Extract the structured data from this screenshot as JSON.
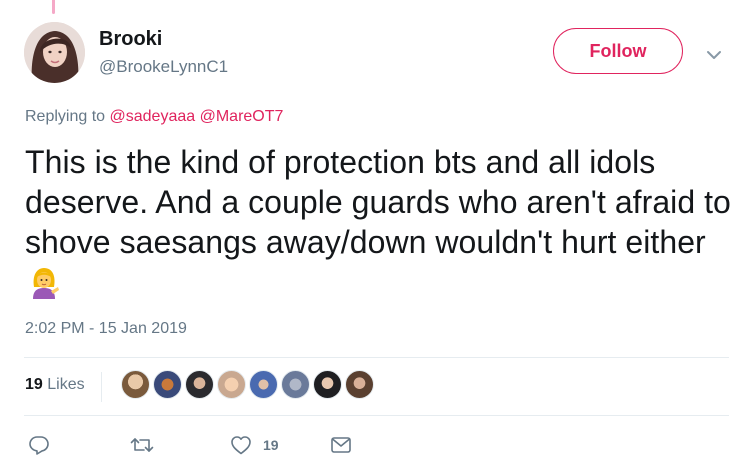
{
  "tweet": {
    "author": {
      "display_name": "Brooki",
      "screen_name": "@BrookeLynnC1",
      "avatar_icon": "user-avatar"
    },
    "follow_label": "Follow",
    "replying_prefix": "Replying to",
    "mentions": [
      "@sadeyaaa",
      "@MareOT7"
    ],
    "text": "This is the kind of protection bts and all idols deserve. And a couple guards who aren't afraid to shove saesangs away/down wouldn't hurt either",
    "emoji_icon": "person-tipping-hand-emoji",
    "timestamp": "2:02 PM - 15 Jan 2019",
    "stats": {
      "likes_count": "19",
      "likes_label": "Likes"
    },
    "actions": {
      "reply_icon": "reply-icon",
      "retweet_icon": "retweet-icon",
      "like_icon": "heart-icon",
      "like_count": "19",
      "dm_icon": "envelope-icon"
    }
  },
  "colors": {
    "accent": "#e0245e",
    "secondary_text": "#657786",
    "primary_text": "#14171a",
    "divider": "#e6ecf0"
  }
}
